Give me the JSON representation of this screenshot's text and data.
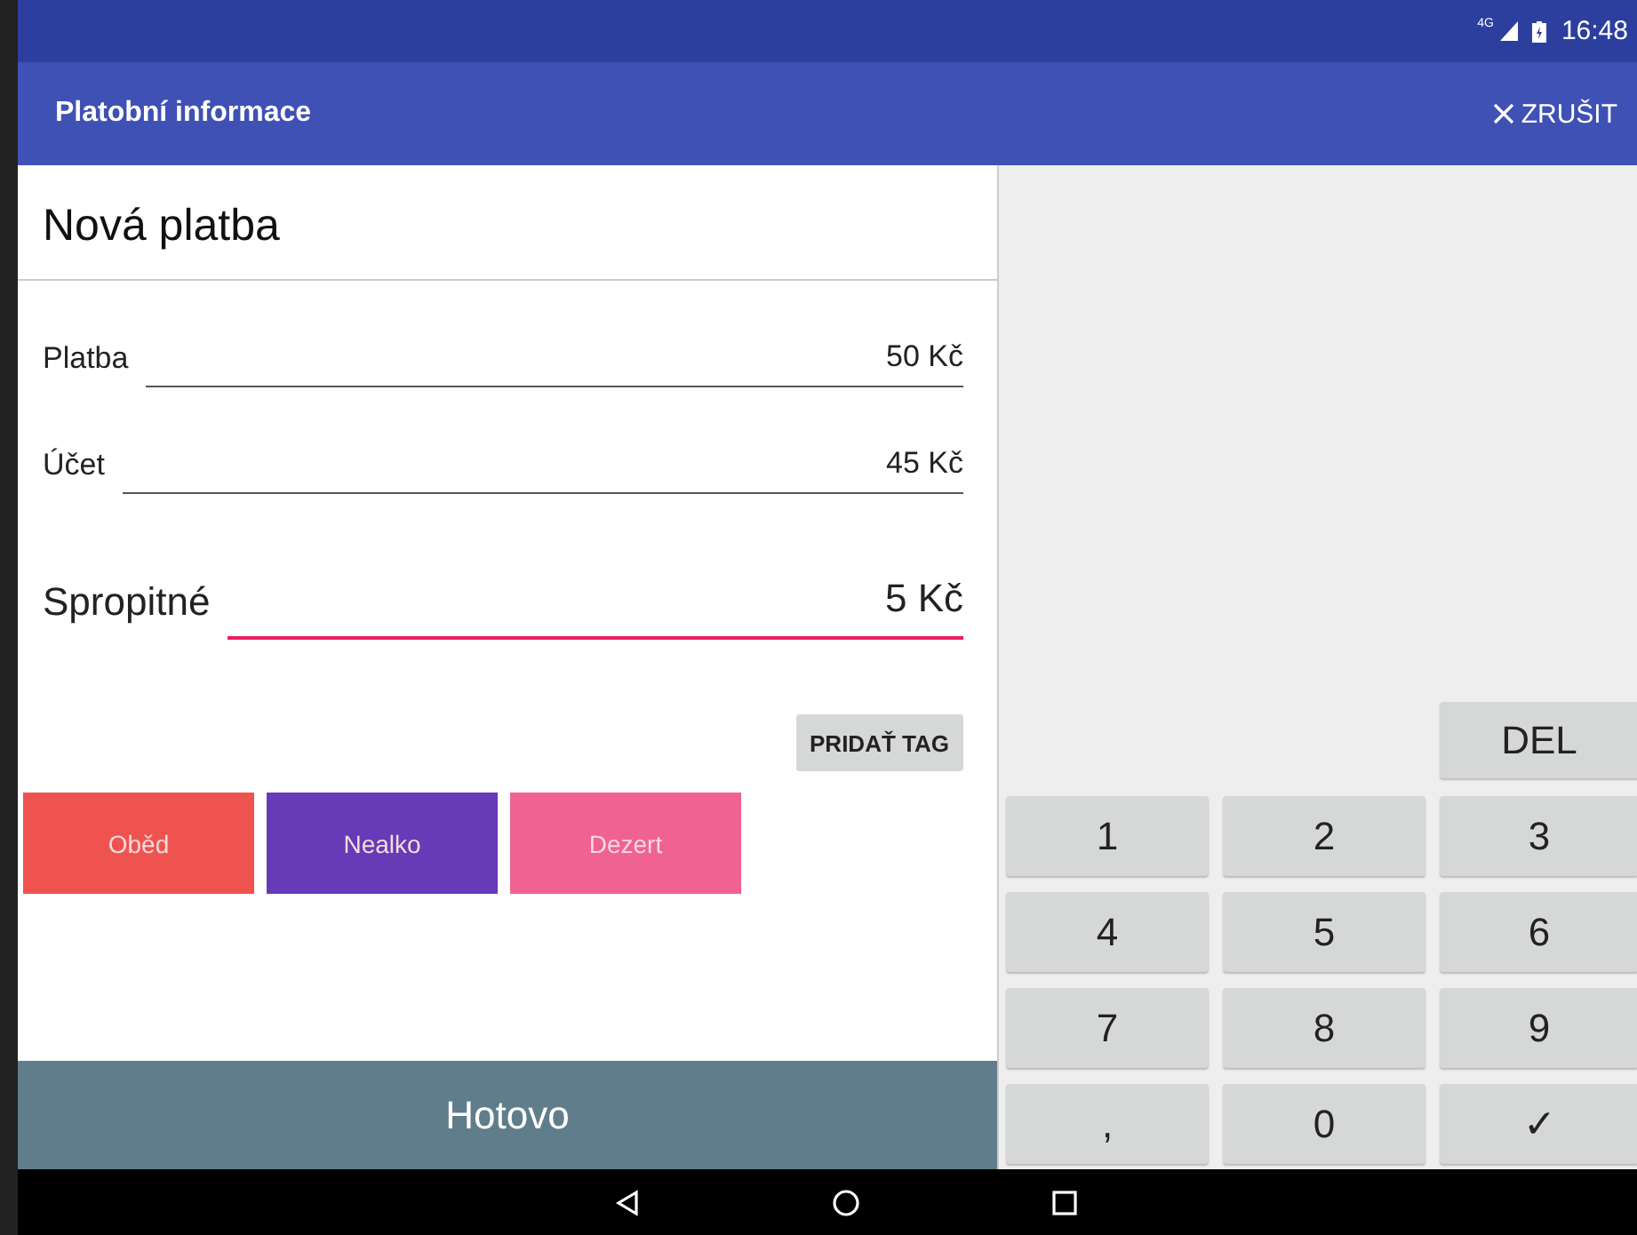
{
  "status_bar": {
    "network": "4G",
    "time": "16:48"
  },
  "app_bar": {
    "title": "Platobní informace",
    "action": "ZRUŠIT"
  },
  "form": {
    "title": "Nová platba",
    "fields": [
      {
        "label": "Platba",
        "value": "50 Kč",
        "selected": false
      },
      {
        "label": "Účet",
        "value": "45 Kč",
        "selected": false
      },
      {
        "label": "Spropitné",
        "value": "5 Kč",
        "selected": true
      }
    ],
    "add_tag_button": "PRIDAŤ TAG",
    "tags": [
      {
        "label": "Oběd",
        "color": "#ef5350"
      },
      {
        "label": "Nealko",
        "color": "#673ab7"
      },
      {
        "label": "Dezert",
        "color": "#f06292"
      }
    ],
    "done_button": "Hotovo"
  },
  "keypad": {
    "delete_key": "DEL",
    "keys": [
      "1",
      "2",
      "3",
      "4",
      "5",
      "6",
      "7",
      "8",
      "9",
      ",",
      "0",
      "✓"
    ]
  }
}
